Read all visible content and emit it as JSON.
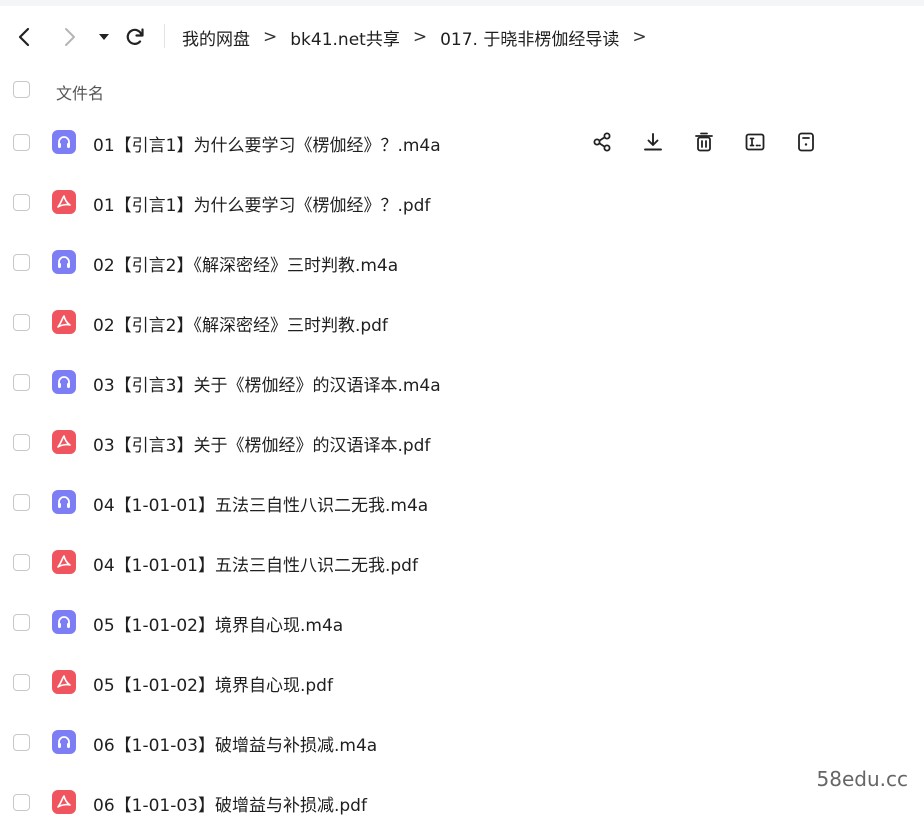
{
  "toolbar": {
    "back_icon": "chevron-left-icon",
    "forward_icon": "chevron-right-icon",
    "dropdown_icon": "caret-down-icon",
    "refresh_icon": "refresh-icon"
  },
  "breadcrumb": {
    "items": [
      "我的网盘",
      "bk41.net共享",
      "017. 于晓非楞伽经导读"
    ],
    "separator": ">"
  },
  "list_header": {
    "name_label": "文件名"
  },
  "files": [
    {
      "name": "01【引言1】为什么要学习《楞伽经》？.m4a",
      "type": "audio"
    },
    {
      "name": "01【引言1】为什么要学习《楞伽经》？.pdf",
      "type": "pdf"
    },
    {
      "name": "02【引言2】《解深密经》三时判教.m4a",
      "type": "audio"
    },
    {
      "name": "02【引言2】《解深密经》三时判教.pdf",
      "type": "pdf"
    },
    {
      "name": "03【引言3】关于《楞伽经》的汉语译本.m4a",
      "type": "audio"
    },
    {
      "name": "03【引言3】关于《楞伽经》的汉语译本.pdf",
      "type": "pdf"
    },
    {
      "name": "04【1-01-01】五法三自性八识二无我.m4a",
      "type": "audio"
    },
    {
      "name": "04【1-01-01】五法三自性八识二无我.pdf",
      "type": "pdf"
    },
    {
      "name": "05【1-01-02】境界自心现.m4a",
      "type": "audio"
    },
    {
      "name": "05【1-01-02】境界自心现.pdf",
      "type": "pdf"
    },
    {
      "name": "06【1-01-03】破增益与补损减.m4a",
      "type": "audio"
    },
    {
      "name": "06【1-01-03】破增益与补损减.pdf",
      "type": "pdf"
    }
  ],
  "row_actions": [
    "share-icon",
    "download-icon",
    "delete-icon",
    "rename-icon",
    "more-info-icon"
  ],
  "watermark": "58edu.cc",
  "colors": {
    "audio_icon": "#7d7ef6",
    "pdf_icon": "#f0545e"
  }
}
